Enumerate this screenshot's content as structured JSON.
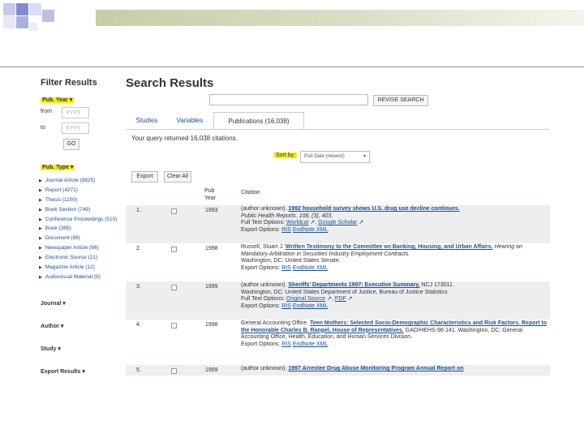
{
  "filter": {
    "title": "Filter Results",
    "pub_year_label": "Pub. Year",
    "from_label": "from",
    "from_placeholder": "YYYY",
    "to_label": "to",
    "to_placeholder": "YYYY",
    "go_label": "GO",
    "pub_type_label": "Pub. Type",
    "pub_types": [
      {
        "label": "Journal Article (9825)"
      },
      {
        "label": "Report (4271)"
      },
      {
        "label": "Thesis (1100)"
      },
      {
        "label": "Book Section (749)"
      },
      {
        "label": "Conference Proceedings (510)"
      },
      {
        "label": "Book (385)"
      },
      {
        "label": "Document (89)"
      },
      {
        "label": "Newspaper Article (66)"
      },
      {
        "label": "Electronic Source (21)"
      },
      {
        "label": "Magazine Article (12)"
      },
      {
        "label": "Audiovisual Material (9)"
      }
    ],
    "accordions": [
      "Journal",
      "Author",
      "Study",
      "Export Results"
    ]
  },
  "results": {
    "title": "Search Results",
    "search_value": "",
    "revise_label": "REVISE SEARCH",
    "tabs": [
      "Studies",
      "Variables",
      "Publications (16,038)"
    ],
    "active_tab": 2,
    "returned_text": "Your query returned 16,038 citations.",
    "sort_label": "Sort by:",
    "sort_value": "Pub Date (newest)",
    "export_label": "Export",
    "clear_label": "Clear All",
    "col_pub": "Pub",
    "col_year": "Year",
    "col_citation": "Citation",
    "rows": [
      {
        "num": "1.",
        "year": "1993",
        "author": "(author unknown).",
        "title": "1992 household survey shows U.S. drug use decline continues.",
        "source": "Public Health Reports. 108, (3), 403.",
        "full_text_label": "Full Text Options:",
        "full_text_links": [
          "Worldcat",
          "Google Scholar"
        ],
        "export_label": "Export Options:",
        "export_links": [
          "RIS",
          "EndNote XML"
        ]
      },
      {
        "num": "2.",
        "year": "1998",
        "author": "Russell, Stuart J.",
        "title": "Written Testimony to the Committee on Banking, Housing, and Urban Affairs.",
        "source": "Hearing on Mandatory Arbitration in Securities Industry Employment Contracts.",
        "place": "Washington, DC: United States Senate.",
        "export_label": "Export Options:",
        "export_links": [
          "RIS",
          "EndNote XML"
        ]
      },
      {
        "num": "3.",
        "year": "1999",
        "author": "(author unknown).",
        "title": "Sheriffs' Departments 1997: Executive Summary.",
        "report": "NCJ 173011.",
        "place": "Washington, DC: United States Department of Justice, Bureau of Justice Statistics.",
        "full_text_label": "Full Text Options:",
        "full_text_links": [
          "Original Source",
          "PDF"
        ],
        "export_label": "Export Options:",
        "export_links": [
          "RIS",
          "EndNote XML"
        ]
      },
      {
        "num": "4.",
        "year": "1998",
        "author": "General Accounting Office.",
        "title": "Teen Mothers: Selected Socio-Demographic Characteristics and Risk Factors. Report to the Honorable Charles B. Rangel, House of Representatives.",
        "report": "GAO/HEHS-98-141.",
        "place": "Washington, DC: General Accounting Office, Health, Education, and Human Services Division.",
        "export_label": "Export Options:",
        "export_links": [
          "RIS",
          "EndNote XML"
        ]
      },
      {
        "num": "5.",
        "year": "1999",
        "author": "(author unknown).",
        "title": "1997 Arrestee Drug Abuse Monitoring Program Annual Report on"
      }
    ]
  },
  "colors": {
    "highlight": "#f6f200",
    "link": "#1a4f9c",
    "band": "#c4cfa7",
    "alt_row": "#eceef0"
  }
}
